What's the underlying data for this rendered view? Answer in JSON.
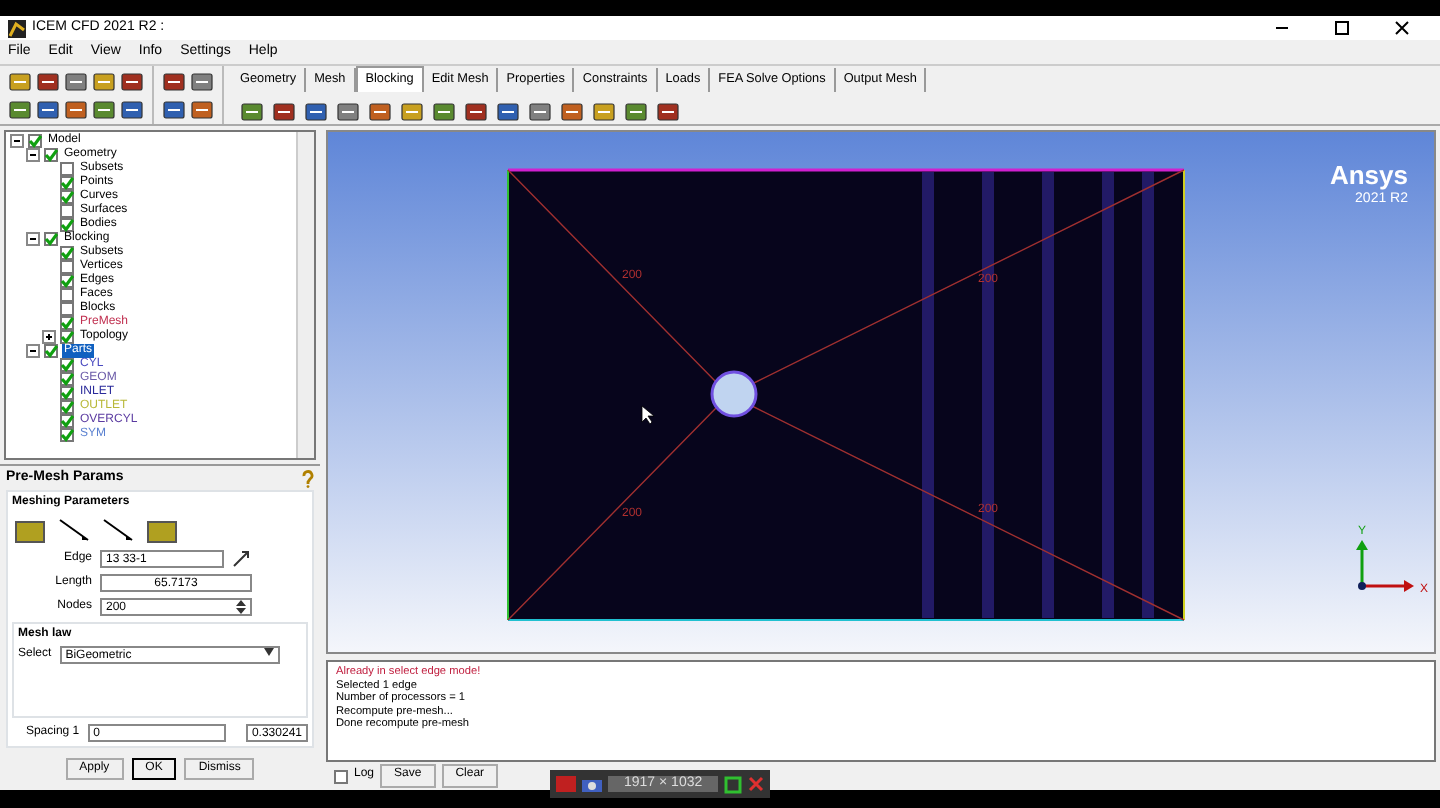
{
  "window": {
    "title": "ICEM CFD 2021 R2 :"
  },
  "menu": [
    "File",
    "Edit",
    "View",
    "Info",
    "Settings",
    "Help"
  ],
  "tabs": [
    {
      "label": "Geometry",
      "selected": false
    },
    {
      "label": "Mesh",
      "selected": false
    },
    {
      "label": "Blocking",
      "selected": true
    },
    {
      "label": "Edit Mesh",
      "selected": false
    },
    {
      "label": "Properties",
      "selected": false
    },
    {
      "label": "Constraints",
      "selected": false
    },
    {
      "label": "Loads",
      "selected": false
    },
    {
      "label": "FEA Solve Options",
      "selected": false
    },
    {
      "label": "Output Mesh",
      "selected": false
    }
  ],
  "tree": [
    {
      "label": "Model",
      "checked": true,
      "expanded": true,
      "selected": false,
      "children": [
        {
          "label": "Geometry",
          "checked": true,
          "expanded": true,
          "selected": false,
          "children": [
            {
              "label": "Subsets",
              "checked": false,
              "selected": false
            },
            {
              "label": "Points",
              "checked": true,
              "selected": false
            },
            {
              "label": "Curves",
              "checked": true,
              "selected": false
            },
            {
              "label": "Surfaces",
              "checked": false,
              "selected": false
            },
            {
              "label": "Bodies",
              "checked": true,
              "selected": false
            }
          ]
        },
        {
          "label": "Blocking",
          "checked": true,
          "expanded": true,
          "selected": false,
          "children": [
            {
              "label": "Subsets",
              "checked": true,
              "selected": false
            },
            {
              "label": "Vertices",
              "checked": false,
              "selected": false
            },
            {
              "label": "Edges",
              "checked": true,
              "selected": false
            },
            {
              "label": "Faces",
              "checked": false,
              "selected": false
            },
            {
              "label": "Blocks",
              "checked": false,
              "selected": false
            },
            {
              "label": "PreMesh",
              "checked": true,
              "selected": false,
              "color": "#c03050"
            },
            {
              "label": "Topology",
              "checked": true,
              "expanded": false,
              "selected": false
            }
          ]
        },
        {
          "label": "Parts",
          "checked": true,
          "expanded": true,
          "selected": true,
          "children": [
            {
              "label": "CYL",
              "checked": true,
              "selected": false,
              "color": "#4a4ac0"
            },
            {
              "label": "GEOM",
              "checked": true,
              "selected": false,
              "color": "#6a5aa8"
            },
            {
              "label": "INLET",
              "checked": true,
              "selected": false,
              "color": "#2a2a9a"
            },
            {
              "label": "OUTLET",
              "checked": true,
              "selected": false,
              "color": "#b8b838"
            },
            {
              "label": "OVERCYL",
              "checked": true,
              "selected": false,
              "color": "#5a3aa0"
            },
            {
              "label": "SYM",
              "checked": true,
              "selected": false,
              "color": "#5a80d0"
            }
          ]
        }
      ]
    }
  ],
  "panel": {
    "title": "Pre-Mesh Params",
    "section": "Meshing Parameters",
    "edge": {
      "label": "Edge",
      "value": "13 33-1"
    },
    "length": {
      "label": "Length",
      "value": "65.7173"
    },
    "nodes": {
      "label": "Nodes",
      "value": "200"
    },
    "mesh_law": {
      "title": "Mesh law",
      "label": "Select",
      "value": "BiGeometric"
    },
    "spacing": {
      "label": "Spacing 1",
      "value": "0",
      "reading": "0.330241"
    },
    "buttons": [
      {
        "label": "Apply",
        "default": false
      },
      {
        "label": "OK",
        "default": true
      },
      {
        "label": "Dismiss",
        "default": false
      }
    ]
  },
  "viewport": {
    "edge_labels": [
      "200",
      "200",
      "200",
      "200"
    ],
    "logo": "Ansys",
    "version": "2021 R2",
    "axes": {
      "y": "Y",
      "x": "X"
    }
  },
  "messages": [
    {
      "text": "Already in select edge mode!",
      "kind": "warning"
    },
    {
      "text": "Selected 1 edge",
      "kind": "info"
    },
    {
      "text": "Number of processors = 1",
      "kind": "info"
    },
    {
      "text": "Recompute pre-mesh...",
      "kind": "info"
    },
    {
      "text": "Done recompute pre-mesh",
      "kind": "info"
    }
  ],
  "message_controls": {
    "log": {
      "label": "Log",
      "checked": false
    },
    "buttons": [
      "Save",
      "Clear"
    ]
  },
  "recorder": {
    "resolution": "1917 × 1032"
  }
}
